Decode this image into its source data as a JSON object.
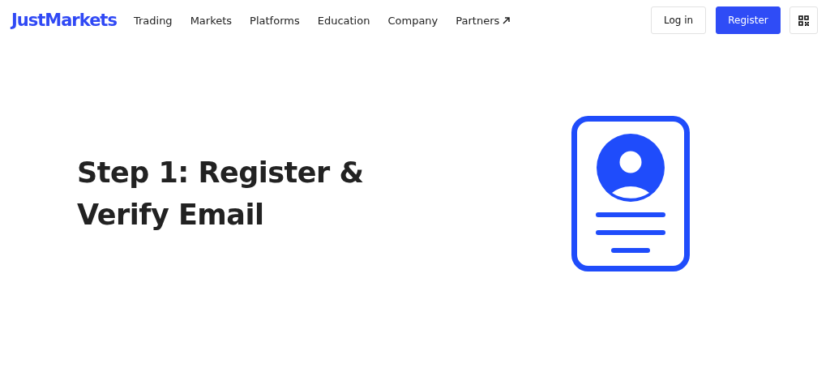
{
  "header": {
    "logo": "JustMarkets",
    "nav": [
      {
        "label": "Trading",
        "kind": "plain"
      },
      {
        "label": "Markets",
        "kind": "plain"
      },
      {
        "label": "Platforms",
        "kind": "plain"
      },
      {
        "label": "Education",
        "kind": "plain"
      },
      {
        "label": "Company",
        "kind": "plain"
      },
      {
        "label": "Partners",
        "kind": "external"
      }
    ],
    "buttons": [
      {
        "label": "Log in",
        "kind": "outline"
      },
      {
        "label": "Register",
        "kind": "primary"
      }
    ]
  },
  "hero": {
    "heading": "Step 1: Register & Verify Email"
  }
}
